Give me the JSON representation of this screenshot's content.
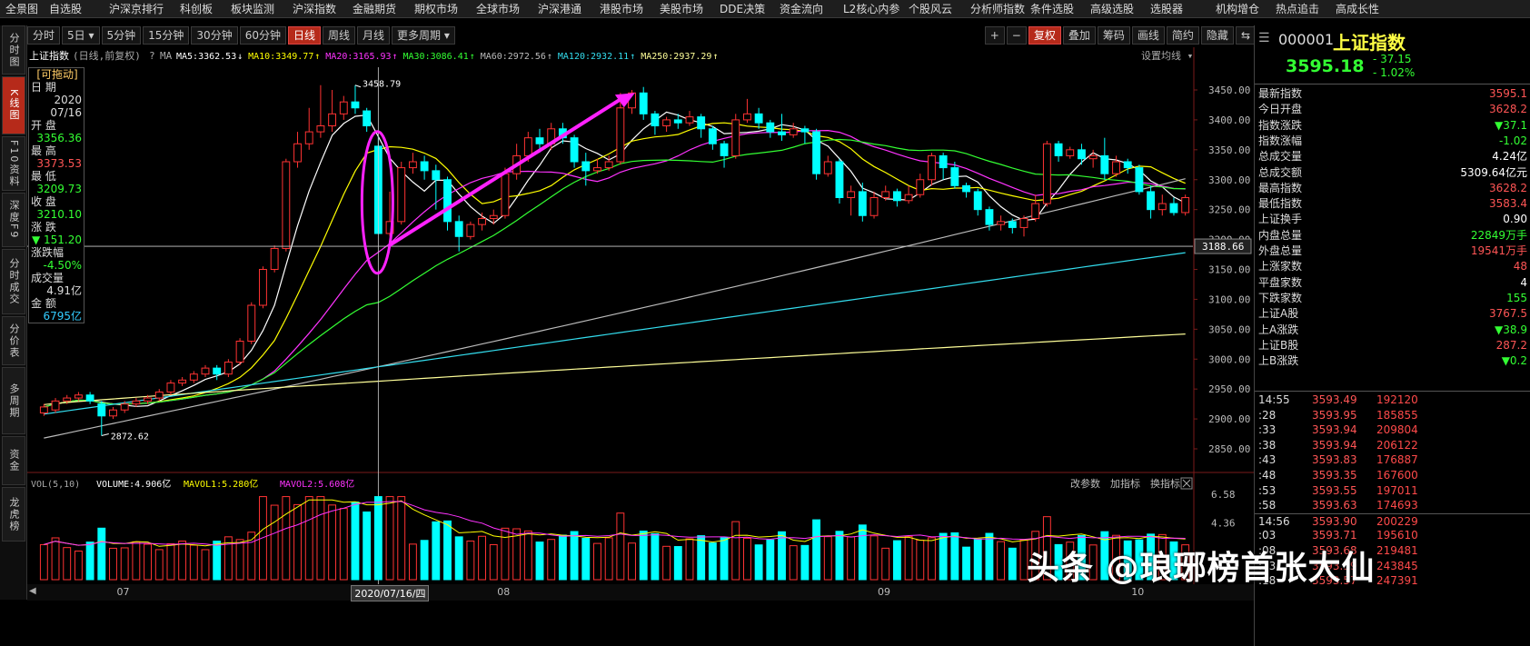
{
  "menu": [
    "全景图",
    "自选股",
    "沪深京排行",
    "科创板",
    "板块监测",
    "沪深指数",
    "金融期货",
    "期权市场",
    "全球市场",
    "沪深港通",
    "港股市场",
    "美股市场",
    "DDE决策",
    "资金流向",
    "L2核心内参",
    "个股风云",
    "分析师指数",
    "条件选股",
    "高级选股",
    "选股器",
    "机构增仓",
    "热点追击",
    "高成长性"
  ],
  "periods": [
    "分时",
    "5日",
    "5分钟",
    "15分钟",
    "30分钟",
    "60分钟",
    "日线",
    "周线",
    "月线",
    "更多周期"
  ],
  "active_period": "日线",
  "tools": {
    "plus": "+",
    "minus": "−",
    "fuquan": "复权",
    "diejia": "叠加",
    "chouma": "筹码",
    "huaxian": "画线",
    "jianyue": "简约",
    "yincang": "隐藏",
    "arrows": "⇆"
  },
  "left_tabs": [
    "分时图",
    "K线图",
    "F10资料",
    "深度F9",
    "分时成交",
    "分价表",
    "多周期",
    "资金",
    "龙虎榜"
  ],
  "ma_bar": {
    "name": "上证指数",
    "desc": "(日线,前复权)",
    "q": "?",
    "ma": "MA",
    "items": [
      {
        "text": "MA5:3362.53",
        "arrow": "↓",
        "color": "#ffffff"
      },
      {
        "text": "MA10:3349.77",
        "arrow": "↑",
        "color": "#ffff00"
      },
      {
        "text": "MA20:3165.93",
        "arrow": "↑",
        "color": "#ff33ff"
      },
      {
        "text": "MA30:3086.41",
        "arrow": "↑",
        "color": "#33ff33"
      },
      {
        "text": "MA60:2972.56",
        "arrow": "↑",
        "color": "#bbbbbb"
      },
      {
        "text": "MA120:2932.11",
        "arrow": "↑",
        "color": "#33ddee"
      },
      {
        "text": "MA250:2937.29",
        "arrow": "↑",
        "color": "#ffff99"
      }
    ],
    "settings": "设置均线"
  },
  "info": {
    "drag": "[可拖动]",
    "date_label": "日 期",
    "year": "2020",
    "md": "07/16",
    "open_label": "开 盘",
    "open": "3356.36",
    "high_label": "最 高",
    "high": "3373.53",
    "low_label": "最 低",
    "low": "3209.73",
    "close_label": "收 盘",
    "close": "3210.10",
    "chg_label": "涨 跌",
    "chg": "▼ 151.20",
    "pct_label": "涨跌幅",
    "pct": "-4.50%",
    "vol_label": "成交量",
    "vol": "4.91亿",
    "amt_label": "金 额",
    "amt": "6795亿"
  },
  "price_axis": [
    "3450.00",
    "3400.00",
    "3350.00",
    "3300.00",
    "3250.00",
    "3200.00",
    "3150.00",
    "3100.00",
    "3050.00",
    "3000.00",
    "2950.00",
    "2900.00",
    "2850.00"
  ],
  "cursor_price": "3188.66",
  "peak_label": "3458.79",
  "low_label": "2872.62",
  "vol_bar": {
    "name": "VOL(5,10)",
    "volume": "VOLUME:4.906亿",
    "mavol1": "MAVOL1:5.280亿",
    "mavol2": "MAVOL2:5.608亿",
    "ops": [
      "改参数",
      "加指标",
      "换指标"
    ]
  },
  "vol_axis": [
    "6.58",
    "4.36"
  ],
  "date_axis": [
    "07",
    "08",
    "09",
    "10"
  ],
  "cursor_date": "2020/07/16/四",
  "right": {
    "code": "000001",
    "name": "上证指数",
    "price": "3595.18",
    "chg": "- 37.15",
    "pct": "- 1.02%",
    "rows": [
      {
        "k": "最新指数",
        "v": "3595.1",
        "c": "#ff5555"
      },
      {
        "k": "今日开盘",
        "v": "3628.2",
        "c": "#ff5555"
      },
      {
        "k": "指数涨跌",
        "v": "▼37.1",
        "c": "#33ff33"
      },
      {
        "k": "指数涨幅",
        "v": "-1.02",
        "c": "#33ff33"
      },
      {
        "k": "总成交量",
        "v": "4.24亿",
        "c": "#ffffff"
      },
      {
        "k": "总成交额",
        "v": "5309.64亿元",
        "c": "#ffffff"
      },
      {
        "k": "最高指数",
        "v": "3628.2",
        "c": "#ff5555"
      },
      {
        "k": "最低指数",
        "v": "3583.4",
        "c": "#ff5555"
      },
      {
        "k": "上证换手",
        "v": "0.90",
        "c": "#ffffff"
      },
      {
        "k": "内盘总量",
        "v": "22849万手",
        "c": "#33ff33"
      },
      {
        "k": "外盘总量",
        "v": "19541万手",
        "c": "#ff5555"
      },
      {
        "k": "上涨家数",
        "v": "48",
        "c": "#ff5555"
      },
      {
        "k": "平盘家数",
        "v": "4",
        "c": "#ffffff"
      },
      {
        "k": "下跌家数",
        "v": "155",
        "c": "#33ff33"
      },
      {
        "k": "上证A股",
        "v": "3767.5",
        "c": "#ff5555"
      },
      {
        "k": "上A涨跌",
        "v": "▼38.9",
        "c": "#33ff33"
      },
      {
        "k": "上证B股",
        "v": "287.2",
        "c": "#ff5555"
      },
      {
        "k": "上B涨跌",
        "v": "▼0.2",
        "c": "#33ff33"
      }
    ],
    "ticks": [
      {
        "t": "14:55",
        "p": "3593.49",
        "q": "192120"
      },
      {
        "t": ":28",
        "p": "3593.95",
        "q": "185855"
      },
      {
        "t": ":33",
        "p": "3593.94",
        "q": "209804"
      },
      {
        "t": ":38",
        "p": "3593.94",
        "q": "206122"
      },
      {
        "t": ":43",
        "p": "3593.83",
        "q": "176887"
      },
      {
        "t": ":48",
        "p": "3593.35",
        "q": "167600"
      },
      {
        "t": ":53",
        "p": "3593.55",
        "q": "197011"
      },
      {
        "t": ":58",
        "p": "3593.63",
        "q": "174693"
      },
      {
        "t": "14:56",
        "p": "3593.90",
        "q": "200229"
      },
      {
        "t": ":03",
        "p": "3593.71",
        "q": "195610"
      },
      {
        "t": ":08",
        "p": "3593.68",
        "q": "219481"
      },
      {
        "t": ":13",
        "p": "3593.59",
        "q": "243845"
      },
      {
        "t": ":18",
        "p": "3593.57",
        "q": "247391"
      }
    ]
  },
  "watermark": "头条 @琅琊榜首张大仙",
  "chart_data": {
    "type": "candlestick",
    "title": "上证指数 (日线,前复权)",
    "y_axis": [
      2850,
      3450
    ],
    "x_months": [
      "07",
      "08",
      "09",
      "10"
    ],
    "candles": [
      [
        2910,
        2920,
        2925,
        2905
      ],
      [
        2915,
        2930,
        2935,
        2910
      ],
      [
        2930,
        2935,
        2940,
        2925
      ],
      [
        2935,
        2940,
        2945,
        2930
      ],
      [
        2940,
        2930,
        2945,
        2925
      ],
      [
        2925,
        2905,
        2930,
        2872
      ],
      [
        2905,
        2915,
        2920,
        2900
      ],
      [
        2915,
        2925,
        2930,
        2910
      ],
      [
        2925,
        2930,
        2935,
        2920
      ],
      [
        2930,
        2935,
        2940,
        2925
      ],
      [
        2935,
        2945,
        2950,
        2930
      ],
      [
        2945,
        2960,
        2965,
        2940
      ],
      [
        2960,
        2965,
        2970,
        2955
      ],
      [
        2965,
        2975,
        2980,
        2960
      ],
      [
        2975,
        2985,
        2990,
        2970
      ],
      [
        2985,
        2975,
        2990,
        2965
      ],
      [
        2975,
        2995,
        3000,
        2970
      ],
      [
        2995,
        3030,
        3035,
        2990
      ],
      [
        3030,
        3090,
        3095,
        3025
      ],
      [
        3090,
        3150,
        3155,
        3085
      ],
      [
        3150,
        3185,
        3190,
        3145
      ],
      [
        3185,
        3330,
        3335,
        3180
      ],
      [
        3330,
        3360,
        3380,
        3320
      ],
      [
        3360,
        3380,
        3420,
        3350
      ],
      [
        3380,
        3390,
        3458,
        3370
      ],
      [
        3390,
        3410,
        3450,
        3380
      ],
      [
        3410,
        3430,
        3440,
        3400
      ],
      [
        3430,
        3420,
        3458,
        3410
      ],
      [
        3415,
        3390,
        3420,
        3380
      ],
      [
        3356,
        3210,
        3373,
        3209
      ],
      [
        3210,
        3230,
        3280,
        3205
      ],
      [
        3230,
        3320,
        3330,
        3225
      ],
      [
        3320,
        3330,
        3345,
        3310
      ],
      [
        3330,
        3315,
        3340,
        3300
      ],
      [
        3315,
        3300,
        3325,
        3250
      ],
      [
        3300,
        3230,
        3305,
        3215
      ],
      [
        3230,
        3205,
        3240,
        3180
      ],
      [
        3205,
        3225,
        3230,
        3200
      ],
      [
        3225,
        3235,
        3245,
        3215
      ],
      [
        3235,
        3240,
        3250,
        3225
      ],
      [
        3240,
        3310,
        3320,
        3235
      ],
      [
        3310,
        3340,
        3360,
        3300
      ],
      [
        3340,
        3370,
        3380,
        3330
      ],
      [
        3370,
        3360,
        3385,
        3345
      ],
      [
        3360,
        3385,
        3395,
        3350
      ],
      [
        3385,
        3370,
        3395,
        3360
      ],
      [
        3370,
        3330,
        3375,
        3320
      ],
      [
        3330,
        3315,
        3345,
        3290
      ],
      [
        3315,
        3320,
        3335,
        3310
      ],
      [
        3320,
        3330,
        3340,
        3315
      ],
      [
        3330,
        3420,
        3445,
        3325
      ],
      [
        3420,
        3445,
        3450,
        3410
      ],
      [
        3445,
        3410,
        3455,
        3400
      ],
      [
        3410,
        3390,
        3415,
        3375
      ],
      [
        3390,
        3400,
        3405,
        3380
      ],
      [
        3400,
        3395,
        3410,
        3385
      ],
      [
        3395,
        3405,
        3415,
        3390
      ],
      [
        3405,
        3385,
        3410,
        3370
      ],
      [
        3385,
        3360,
        3390,
        3350
      ],
      [
        3360,
        3340,
        3365,
        3320
      ],
      [
        3340,
        3400,
        3410,
        3335
      ],
      [
        3400,
        3410,
        3435,
        3395
      ],
      [
        3410,
        3395,
        3420,
        3385
      ],
      [
        3395,
        3380,
        3400,
        3370
      ],
      [
        3380,
        3375,
        3410,
        3365
      ],
      [
        3375,
        3385,
        3395,
        3370
      ],
      [
        3385,
        3380,
        3390,
        3360
      ],
      [
        3380,
        3310,
        3385,
        3300
      ],
      [
        3310,
        3330,
        3340,
        3305
      ],
      [
        3330,
        3270,
        3335,
        3260
      ],
      [
        3270,
        3280,
        3290,
        3240
      ],
      [
        3280,
        3240,
        3295,
        3230
      ],
      [
        3240,
        3270,
        3280,
        3235
      ],
      [
        3270,
        3280,
        3290,
        3265
      ],
      [
        3280,
        3265,
        3285,
        3255
      ],
      [
        3265,
        3275,
        3290,
        3260
      ],
      [
        3275,
        3300,
        3310,
        3270
      ],
      [
        3300,
        3340,
        3345,
        3290
      ],
      [
        3340,
        3320,
        3345,
        3300
      ],
      [
        3320,
        3290,
        3330,
        3285
      ],
      [
        3290,
        3280,
        3295,
        3270
      ],
      [
        3280,
        3250,
        3285,
        3240
      ],
      [
        3250,
        3225,
        3255,
        3215
      ],
      [
        3225,
        3230,
        3240,
        3215
      ],
      [
        3230,
        3220,
        3235,
        3210
      ],
      [
        3220,
        3235,
        3240,
        3205
      ],
      [
        3235,
        3260,
        3275,
        3230
      ],
      [
        3260,
        3360,
        3365,
        3255
      ],
      [
        3360,
        3340,
        3365,
        3330
      ],
      [
        3340,
        3350,
        3355,
        3335
      ],
      [
        3350,
        3335,
        3360,
        3325
      ],
      [
        3335,
        3340,
        3350,
        3320
      ],
      [
        3340,
        3310,
        3370,
        3300
      ],
      [
        3310,
        3330,
        3340,
        3305
      ],
      [
        3330,
        3320,
        3335,
        3310
      ],
      [
        3320,
        3280,
        3325,
        3275
      ],
      [
        3280,
        3250,
        3290,
        3235
      ],
      [
        3250,
        3260,
        3275,
        3240
      ],
      [
        3260,
        3245,
        3270,
        3240
      ],
      [
        3245,
        3270,
        3275,
        3240
      ]
    ],
    "volume_range": [
      0,
      6.58
    ]
  }
}
